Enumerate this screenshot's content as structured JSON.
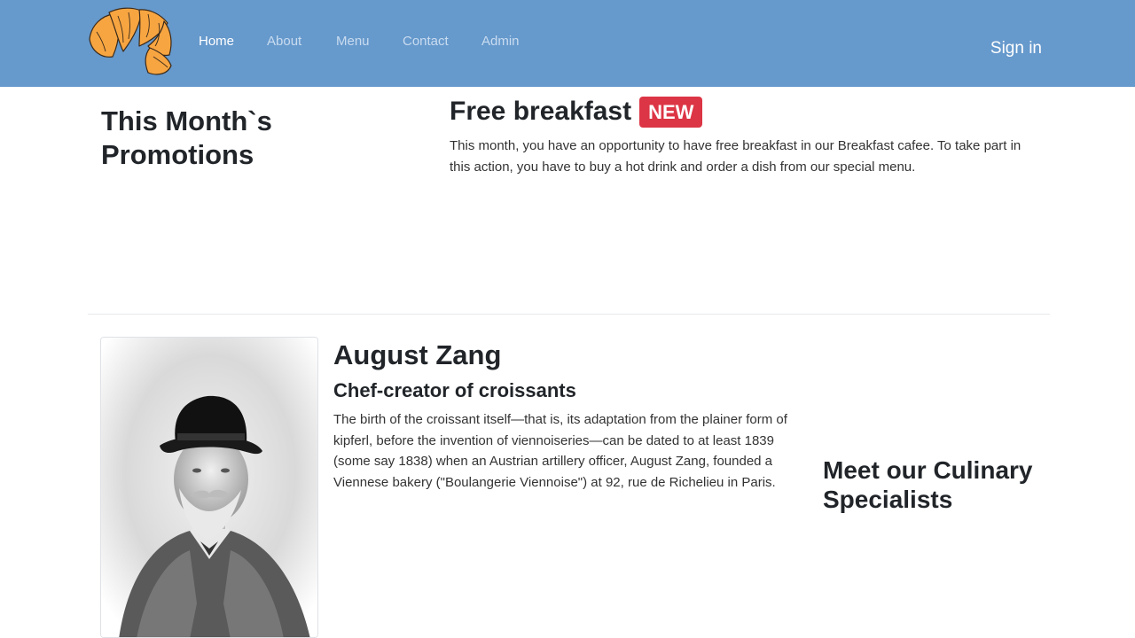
{
  "nav": {
    "items": [
      {
        "label": "Home",
        "active": true
      },
      {
        "label": "About"
      },
      {
        "label": "Menu"
      },
      {
        "label": "Contact"
      },
      {
        "label": "Admin"
      }
    ],
    "signin_label": "Sign in",
    "logo_icon": "croissant-icon"
  },
  "promotions": {
    "title": "This Month`s Promotions",
    "offer": {
      "title": "Free breakfast",
      "badge": "NEW",
      "text": "This month, you have an opportunity to have free breakfast in our Breakfast cafee. To take part in this action, you have to buy a hot drink and order a dish from our special menu."
    }
  },
  "specialist": {
    "name": "August Zang",
    "role": "Chef-creator of croissants",
    "bio": "The birth of the croissant itself—that is, its adaptation from the plainer form of kipferl, before the invention of viennoiseries—can be dated to at least 1839 (some say 1838) when an Austrian artillery officer, August Zang, founded a Viennese bakery (\"Boulangerie Viennoise\") at 92, rue de Richelieu in Paris."
  },
  "meet": {
    "title": "Meet our Culinary Specialists"
  },
  "colors": {
    "navbar": "#6699cc",
    "badge": "#dc3545",
    "croissant": "#f7a541"
  }
}
